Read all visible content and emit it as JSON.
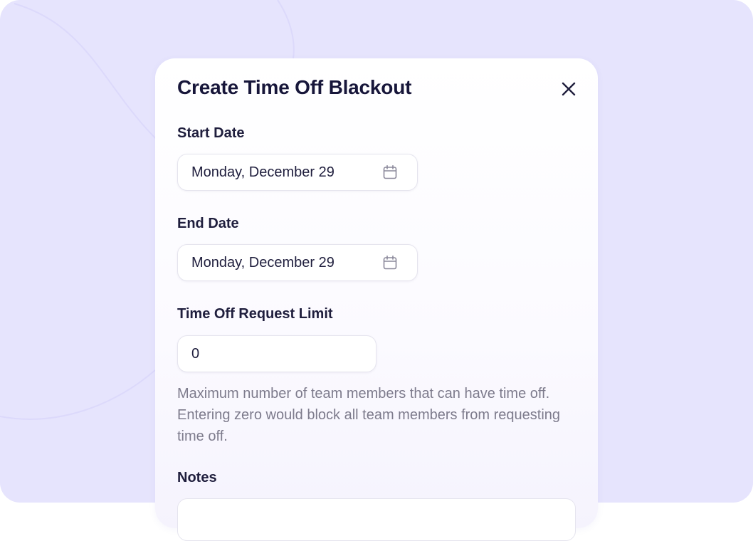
{
  "modal": {
    "title": "Create Time Off Blackout",
    "close_icon": "close-icon"
  },
  "start_date": {
    "label": "Start Date",
    "value": "Monday, December 29",
    "icon": "calendar-icon"
  },
  "end_date": {
    "label": "End Date",
    "value": "Monday, December 29",
    "icon": "calendar-icon"
  },
  "request_limit": {
    "label": "Time Off Request Limit",
    "value": "0",
    "help": "Maximum number of team members that can have time off. Entering zero would block all team members from requesting time off."
  },
  "notes": {
    "label": "Notes",
    "value": ""
  },
  "colors": {
    "backdrop": "#e6e4fd",
    "text_primary": "#1f1e3d",
    "text_muted": "#7d7b8c",
    "border": "#e5e4ee"
  }
}
